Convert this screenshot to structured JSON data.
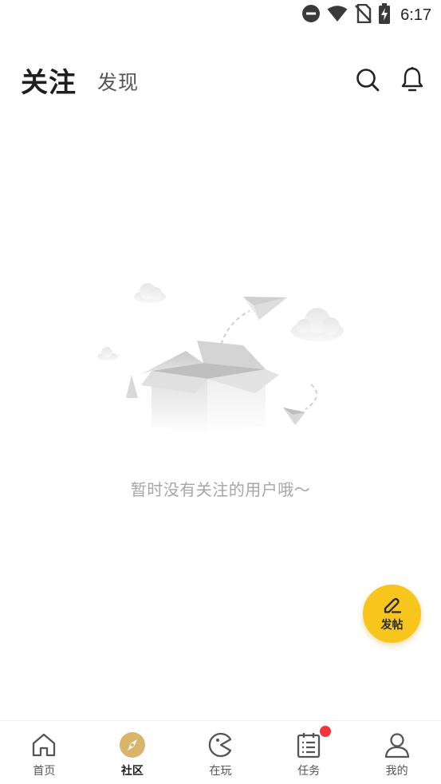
{
  "status_bar": {
    "time": "6:17",
    "icons": [
      "do-not-disturb-icon",
      "wifi-icon",
      "no-sim-icon",
      "battery-charging-icon"
    ]
  },
  "header": {
    "tab_follow": "关注",
    "tab_discover": "发现",
    "active_tab": "关注",
    "icons": [
      "search-icon",
      "bell-icon"
    ]
  },
  "empty_state": {
    "message": "暂时没有关注的用户哦～",
    "illustration": "open-box-with-paper-planes-and-clouds"
  },
  "fab": {
    "label": "发帖",
    "icon": "edit-pencil-icon",
    "color": "#f8c51d"
  },
  "bottom_nav": {
    "active": "社区",
    "active_color": "#d9b46b",
    "badge_color": "#f2353a",
    "items": [
      {
        "label": "首页",
        "icon": "home-icon"
      },
      {
        "label": "社区",
        "icon": "compass-icon"
      },
      {
        "label": "在玩",
        "icon": "pacman-icon"
      },
      {
        "label": "任务",
        "icon": "calendar-list-icon",
        "badge": "dot"
      },
      {
        "label": "我的",
        "icon": "user-icon"
      }
    ]
  }
}
